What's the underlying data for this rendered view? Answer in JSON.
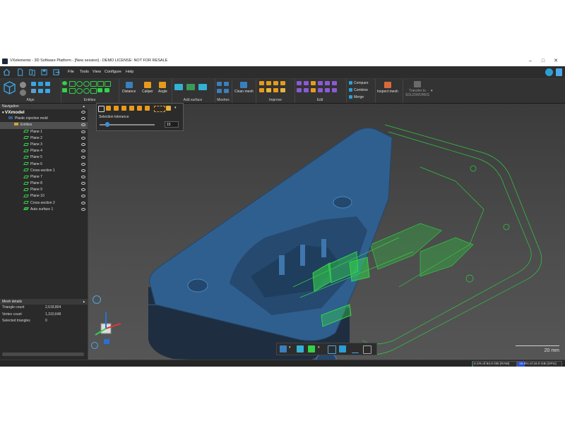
{
  "window": {
    "title": "VXelements - 3D Software Platform - [New session] - DEMO LICENSE: NOT FOR RESALE"
  },
  "menu": [
    "File",
    "Tools",
    "View",
    "Configure",
    "Help"
  ],
  "ribbon": {
    "groups": [
      {
        "label": "Align"
      },
      {
        "label": "Entities"
      },
      {
        "label": "Add surface"
      },
      {
        "label": "Meshes"
      },
      {
        "label": "Improve"
      },
      {
        "label": "Edit"
      }
    ],
    "buttons": {
      "distance": "Distance",
      "caliper": "Caliper",
      "angle": "Angle",
      "clean_mesh": "Clean mesh",
      "compare": "Compare",
      "combine": "Combine",
      "merge": "Merge",
      "inspect_mesh": "Inspect mesh",
      "transfer_line1": "Transfer to",
      "transfer_line2": "SOLIDWORKS"
    }
  },
  "navigation": {
    "header": "Navigation",
    "root": "VXmodel",
    "object": "Plastic injection mold",
    "folder": "Entities",
    "entities": [
      "Plane 1",
      "Plane 2",
      "Plane 3",
      "Plane 4",
      "Plane 5",
      "Plane 6",
      "Cross-section 1",
      "Plane 7",
      "Plane 8",
      "Plane 9",
      "Plane 10",
      "Cross-section 2",
      "Auto surface 1"
    ]
  },
  "mesh_details": {
    "header": "Mesh details",
    "rows": [
      {
        "label": "Triangle count",
        "value": "2,618,804"
      },
      {
        "label": "Vertex count",
        "value": "1,310,648"
      },
      {
        "label": "Selected triangles",
        "value": "0"
      }
    ]
  },
  "selection_panel": {
    "tolerance_label": "Selection tolerance",
    "tolerance_value": "15",
    "tolerance_level": 0.1
  },
  "viewport": {
    "scale_label": "20 mm"
  },
  "status": {
    "ram_text": "2.1% of 64.0 GB (RAM)",
    "ram_fraction": 0.021,
    "gpu_text": "16.6% of 16.0 GB (GPU)",
    "gpu_fraction": 0.166
  },
  "colors": {
    "accent": "#2a9fd6",
    "model": "#2f5f8f",
    "entity_green": "#33d14a",
    "background": "#2b2b2b"
  },
  "icons": {
    "window": [
      "app-logo-icon",
      "minimize-icon",
      "maximize-icon",
      "close-icon"
    ],
    "quick": [
      "home-icon",
      "new-icon",
      "open-icon",
      "save-icon",
      "export-icon"
    ]
  }
}
